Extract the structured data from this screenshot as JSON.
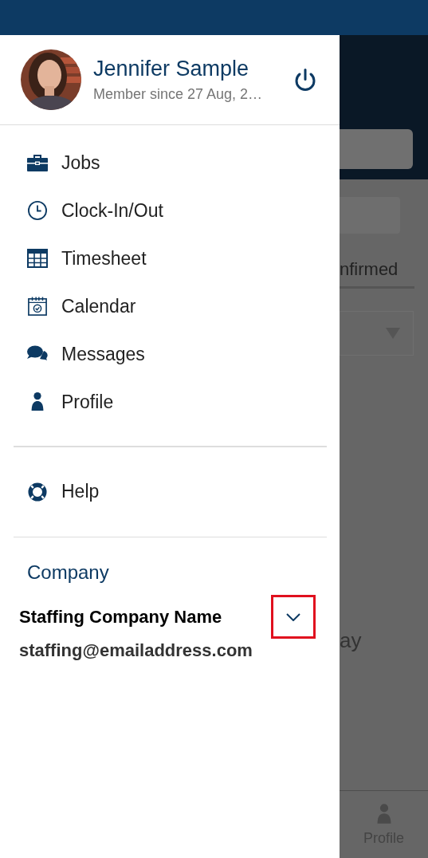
{
  "drawer": {
    "user": {
      "name": "Jennifer Sample",
      "subtitle": "Member since 27 Aug, 2…"
    },
    "menu": [
      {
        "kind": "jobs",
        "label": "Jobs"
      },
      {
        "kind": "clock",
        "label": "Clock-In/Out"
      },
      {
        "kind": "timesheet",
        "label": "Timesheet"
      },
      {
        "kind": "calendar",
        "label": "Calendar"
      },
      {
        "kind": "messages",
        "label": "Messages"
      },
      {
        "kind": "profile",
        "label": "Profile"
      }
    ],
    "secondary_menu": [
      {
        "kind": "help",
        "label": "Help"
      }
    ],
    "company": {
      "heading": "Company",
      "name": "Staffing Company Name",
      "email": "staffing@emailaddress.com"
    }
  },
  "background": {
    "tab_label": "nfirmed",
    "body_text": "ay",
    "bottom_nav": [
      {
        "kind": "profile",
        "label": "Profile"
      }
    ]
  }
}
